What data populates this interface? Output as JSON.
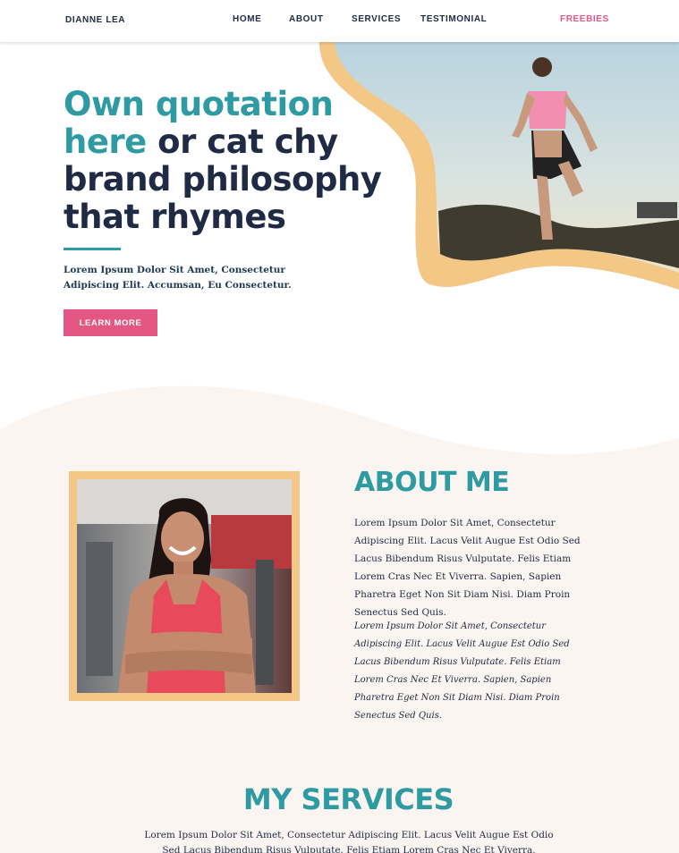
{
  "header": {
    "logo": "DIANNE LEA",
    "nav": [
      "HOME",
      "ABOUT",
      "SERVICES",
      "TESTIMONIAL"
    ],
    "freebies": "FREEBIES"
  },
  "hero": {
    "title_teal": "Own quotation here",
    "title_dark": "or cat chy brand philosophy that rhymes",
    "subtitle": "Lorem Ipsum Dolor Sit Amet, Consectetur Adipiscing Elit. Accumsan, Eu Consectetur.",
    "cta": "LEARN MORE"
  },
  "about": {
    "title": "ABOUT ME",
    "paragraph1": "Lorem Ipsum Dolor Sit Amet, Consectetur Adipiscing Elit. Lacus Velit Augue Est Odio Sed Lacus Bibendum Risus Vulputate. Felis Etiam Lorem Cras Nec Et Viverra. Sapien, Sapien Pharetra Eget Non Sit Diam Nisi. Diam Proin Senectus Sed Quis.",
    "paragraph2": "Lorem Ipsum Dolor Sit Amet, Consectetur Adipiscing Elit. Lacus Velit Augue Est Odio Sed Lacus Bibendum Risus Vulputate. Felis Etiam Lorem Cras Nec Et Viverra. Sapien, Sapien Pharetra Eget Non Sit Diam Nisi. Diam Proin Senectus Sed Quis."
  },
  "services": {
    "title": "MY SERVICES",
    "text": "Lorem Ipsum Dolor Sit Amet, Consectetur Adipiscing Elit. Lacus Velit Augue Est Odio Sed Lacus Bibendum Risus Vulputate. Felis Etiam Lorem Cras Nec Et Viverra."
  },
  "colors": {
    "teal": "#2e9aa2",
    "navy": "#1f2a44",
    "pink": "#e45683",
    "sand": "#f3c785",
    "cream": "#faf5f1"
  }
}
